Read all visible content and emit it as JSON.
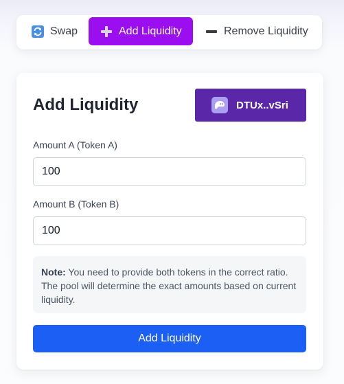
{
  "tabs": [
    {
      "label": "Swap",
      "icon": "refresh-icon",
      "active": false
    },
    {
      "label": "Add Liquidity",
      "icon": "plus-icon",
      "active": true
    },
    {
      "label": "Remove Liquidity",
      "icon": "minus-icon",
      "active": false
    }
  ],
  "card": {
    "title": "Add Liquidity",
    "wallet": {
      "address": "DTUx..vSri",
      "icon": "phantom-wallet-icon"
    },
    "amount_a": {
      "label": "Amount A (Token A)",
      "value": "100"
    },
    "amount_b": {
      "label": "Amount B (Token B)",
      "value": "100"
    },
    "note": {
      "prefix": "Note:",
      "text": " You need to provide both tokens in the correct ratio. The pool will determine the exact amounts based on current liquidity."
    },
    "submit_label": "Add Liquidity"
  },
  "colors": {
    "active_tab": "#9b0ef0",
    "wallet_button": "#5a27a8",
    "primary_button": "#1c5ff5",
    "note_background": "#f5f6f8"
  }
}
